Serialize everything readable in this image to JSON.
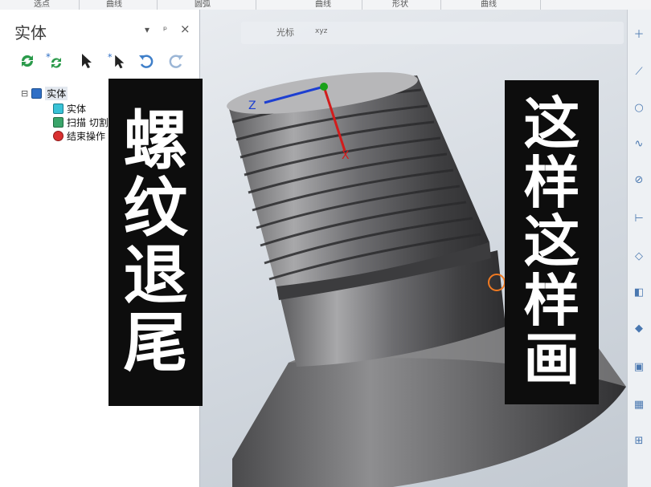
{
  "topbar": {
    "tabs": [
      "选点",
      "曲线",
      "圆弧",
      "曲线",
      "形状",
      "曲线"
    ]
  },
  "panel": {
    "title": "实体",
    "controls": {
      "dropdown": "▾",
      "pin": "ᵖ",
      "close": "×"
    },
    "tree": {
      "collapse": "⊟",
      "root": "实体",
      "children": [
        "实体",
        "扫描 切割",
        "结束操作"
      ]
    }
  },
  "viewport": {
    "toolbar_label": "光标",
    "coord_label": "xyz",
    "axis_labels": {
      "z": "Z",
      "x": "X"
    }
  },
  "captions": {
    "left": [
      "螺",
      "纹",
      "退",
      "尾"
    ],
    "right": [
      "这",
      "样",
      "这",
      "样",
      "画"
    ]
  },
  "colors": {
    "caption_bg": "#0d0d0d",
    "caption_text": "#ffffff",
    "accent_blue": "#2f6fc6",
    "axis_x": "#d21c1c",
    "axis_y": "#1aa11a",
    "axis_z": "#1d3fd1"
  }
}
